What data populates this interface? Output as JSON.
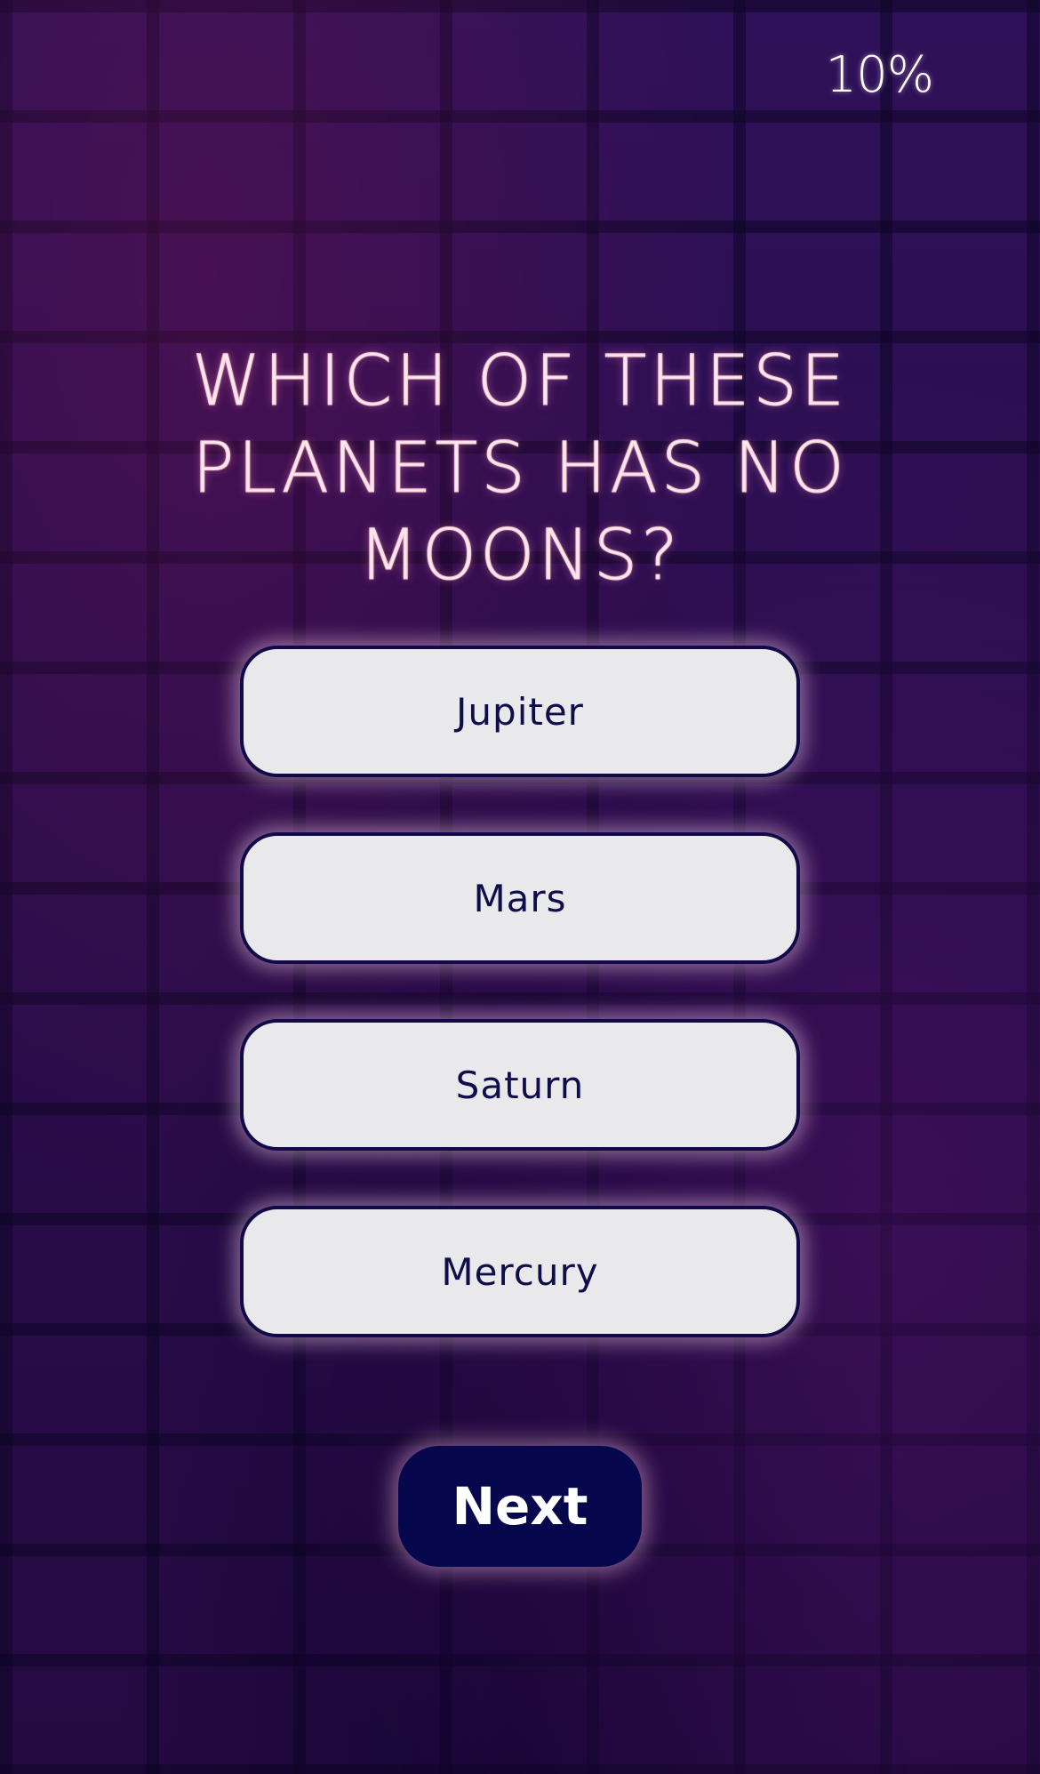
{
  "progress": {
    "label": "10%"
  },
  "question": {
    "text": "WHICH OF THESE PLANETS HAS NO MOONS?"
  },
  "answers": [
    {
      "label": "Jupiter"
    },
    {
      "label": "Mars"
    },
    {
      "label": "Saturn"
    },
    {
      "label": "Mercury"
    }
  ],
  "actions": {
    "next_label": "Next"
  },
  "colors": {
    "background": "#2b0f4f",
    "answer_fill": "#e9e9ec",
    "answer_text": "#0f0d4a",
    "answer_border": "#120a48",
    "next_fill": "#07074d",
    "next_text": "#ffffff",
    "question_text": "#fde8ee"
  }
}
